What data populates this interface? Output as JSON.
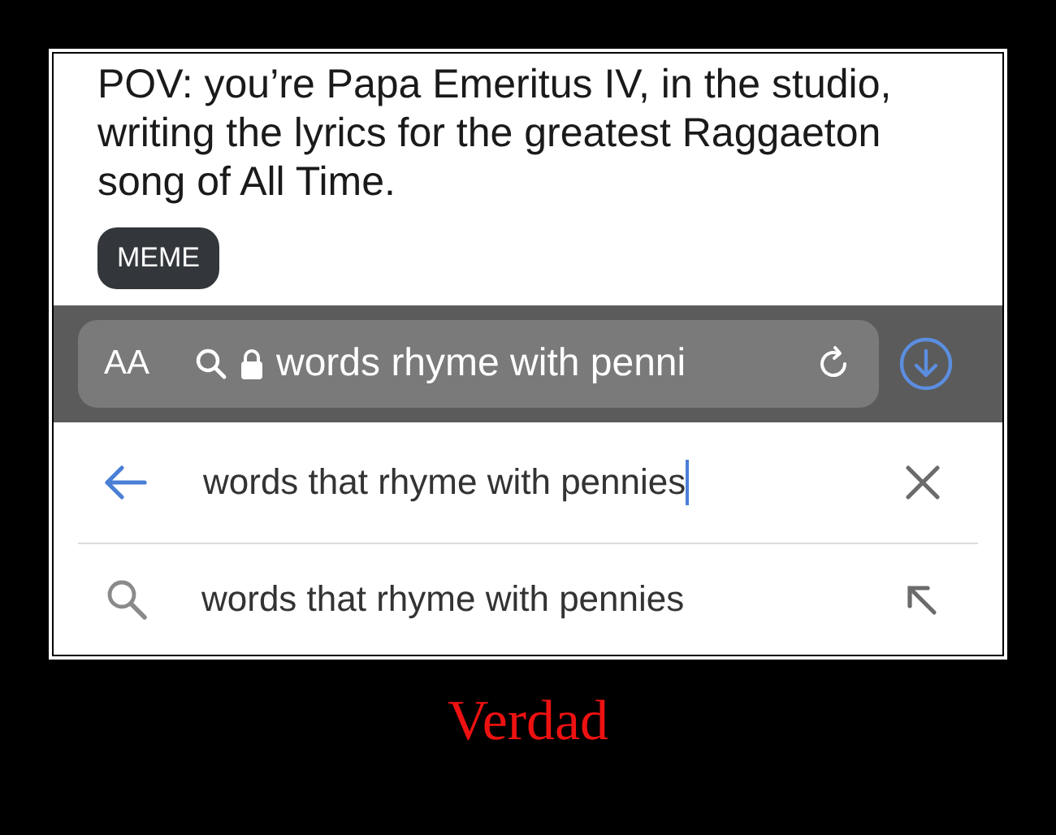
{
  "post": {
    "title": "POV: you’re Papa Emeritus IV, in the studio, writing the lyrics for the greatest Raggaeton song of All Time.",
    "tag": "MEME"
  },
  "address_bar": {
    "text_size_label": "AA",
    "url": "words rhyme with penni"
  },
  "search": {
    "value": "words that rhyme with pennies"
  },
  "suggestions": [
    {
      "text": "words that rhyme with pennies"
    }
  ],
  "caption": "Verdad"
}
